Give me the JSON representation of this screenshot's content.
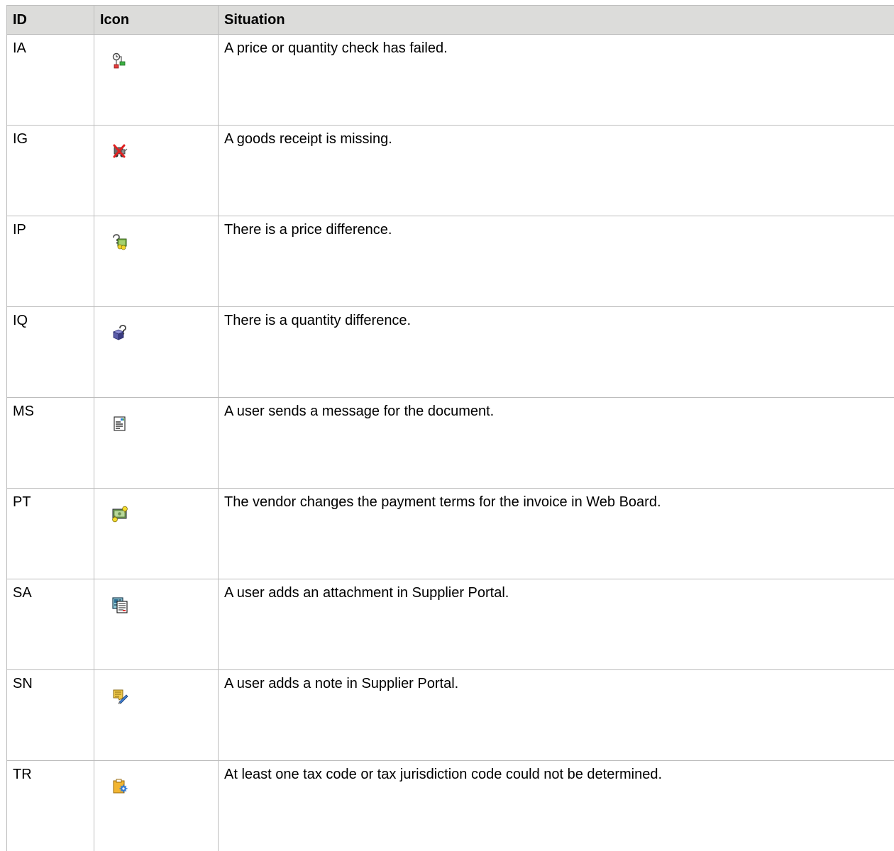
{
  "table": {
    "headers": {
      "id": "ID",
      "icon": "Icon",
      "situation": "Situation"
    },
    "rows": [
      {
        "id": "IA",
        "icon": "price-quantity-check-failed-icon",
        "situation": "A price or quantity check has failed."
      },
      {
        "id": "IG",
        "icon": "goods-receipt-missing-icon",
        "situation": "A goods receipt is missing."
      },
      {
        "id": "IP",
        "icon": "price-difference-icon",
        "situation": "There is a price difference."
      },
      {
        "id": "IQ",
        "icon": "quantity-difference-icon",
        "situation": "There is a quantity difference."
      },
      {
        "id": "MS",
        "icon": "message-document-icon",
        "situation": "A user sends a message for the document."
      },
      {
        "id": "PT",
        "icon": "payment-terms-icon",
        "situation": "The vendor changes the payment terms for the invoice in Web Board."
      },
      {
        "id": "SA",
        "icon": "attachment-icon",
        "situation": "A user adds an attachment in Supplier Portal."
      },
      {
        "id": "SN",
        "icon": "note-edit-icon",
        "situation": "A user adds a note in Supplier Portal."
      },
      {
        "id": "TR",
        "icon": "tax-code-icon",
        "situation": "At least one tax code or tax jurisdiction code could not be determined."
      }
    ]
  }
}
